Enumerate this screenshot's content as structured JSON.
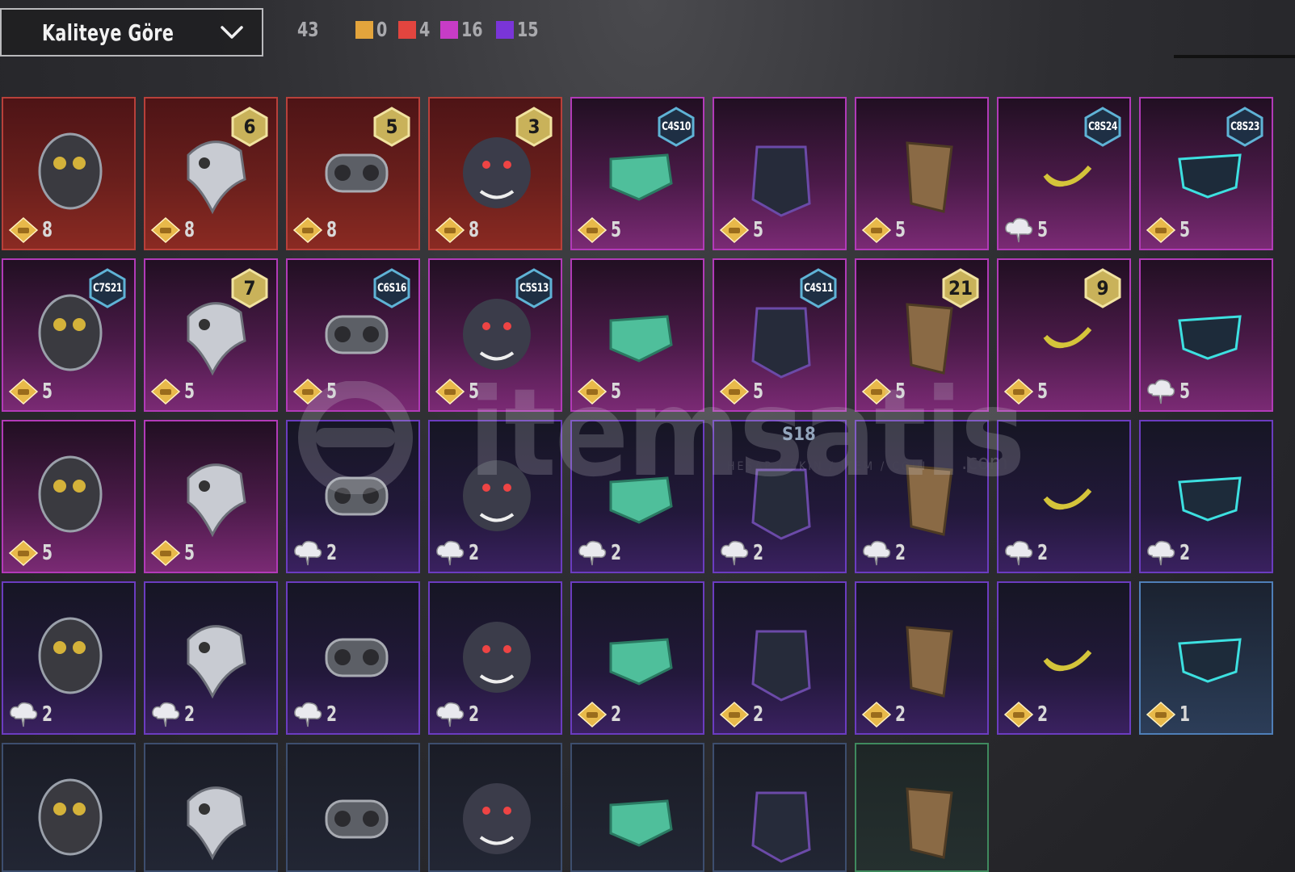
{
  "toolbar": {
    "sort_label": "Kaliteye Göre",
    "total_count": "43",
    "tiers": [
      {
        "color": "#e3a43c",
        "count": "0"
      },
      {
        "color": "#e2453f",
        "count": "4"
      },
      {
        "color": "#c73cc6",
        "count": "16"
      },
      {
        "color": "#7a35d8",
        "count": "15"
      }
    ]
  },
  "watermark": {
    "brand": "itemsatis",
    "tagline": "HESAP / SKIN / ITEM / COIN",
    "domain": ".com"
  },
  "labels": {
    "s18": "S18"
  },
  "cost_icons": {
    "gold": "gold-diamond-icon",
    "silver": "silver-cloud-coin-icon"
  },
  "items": [
    {
      "quality": "red",
      "icon": "helmet-mask-icon",
      "cost_type": "gold",
      "cost": "8",
      "badge": ""
    },
    {
      "quality": "red",
      "icon": "plague-doctor-mask-icon",
      "cost_type": "gold",
      "cost": "8",
      "badge": "6"
    },
    {
      "quality": "red",
      "icon": "gas-mask-icon",
      "cost_type": "gold",
      "cost": "8",
      "badge": "5"
    },
    {
      "quality": "red",
      "icon": "wolf-mask-icon",
      "cost_type": "gold",
      "cost": "8",
      "badge": "3"
    },
    {
      "quality": "pink",
      "icon": "face-mask-icon",
      "cost_type": "gold",
      "cost": "5",
      "badge": "C4S10",
      "season": true
    },
    {
      "quality": "pink",
      "icon": "bandana-icon",
      "cost_type": "gold",
      "cost": "5",
      "badge": ""
    },
    {
      "quality": "pink",
      "icon": "scarf-mask-icon",
      "cost_type": "gold",
      "cost": "5",
      "badge": ""
    },
    {
      "quality": "pink",
      "icon": "mustache-mask-icon",
      "cost_type": "silver",
      "cost": "5",
      "badge": "C8S24",
      "season": true
    },
    {
      "quality": "pink",
      "icon": "neon-mask-icon",
      "cost_type": "gold",
      "cost": "5",
      "badge": "C8S23",
      "season": true
    },
    {
      "quality": "pink",
      "icon": "robot-mask-icon",
      "cost_type": "gold",
      "cost": "5",
      "badge": "C7S21",
      "season": true
    },
    {
      "quality": "pink",
      "icon": "headset-mask-icon",
      "cost_type": "gold",
      "cost": "5",
      "badge": "7"
    },
    {
      "quality": "pink",
      "icon": "respirator-icon",
      "cost_type": "gold",
      "cost": "5",
      "badge": "C6S16",
      "season": true
    },
    {
      "quality": "pink",
      "icon": "graffiti-mask-icon",
      "cost_type": "gold",
      "cost": "5",
      "badge": "C5S13",
      "season": true
    },
    {
      "quality": "pink",
      "icon": "knight-mask-icon",
      "cost_type": "gold",
      "cost": "5",
      "badge": ""
    },
    {
      "quality": "pink",
      "icon": "cyber-mask-icon",
      "cost_type": "gold",
      "cost": "5",
      "badge": "C4S11",
      "season": true
    },
    {
      "quality": "pink",
      "icon": "joker-mask-icon",
      "cost_type": "gold",
      "cost": "5",
      "badge": "21"
    },
    {
      "quality": "pink",
      "icon": "armor-mask-icon",
      "cost_type": "gold",
      "cost": "5",
      "badge": "9"
    },
    {
      "quality": "pink",
      "icon": "skull-mask-icon",
      "cost_type": "silver",
      "cost": "5",
      "badge": ""
    },
    {
      "quality": "pink",
      "icon": "beak-mask-icon",
      "cost_type": "gold",
      "cost": "5",
      "badge": ""
    },
    {
      "quality": "pink",
      "icon": "skull-bandana-icon",
      "cost_type": "gold",
      "cost": "5",
      "badge": ""
    },
    {
      "quality": "purple",
      "icon": "laser-mask-icon",
      "cost_type": "silver",
      "cost": "2",
      "badge": ""
    },
    {
      "quality": "purple",
      "icon": "mammoth-mask-icon",
      "cost_type": "silver",
      "cost": "2",
      "badge": ""
    },
    {
      "quality": "purple",
      "icon": "pink-animal-mask-icon",
      "cost_type": "silver",
      "cost": "2",
      "badge": ""
    },
    {
      "quality": "purple",
      "icon": "heartbeat-mask-icon",
      "cost_type": "silver",
      "cost": "2",
      "badge": ""
    },
    {
      "quality": "purple",
      "icon": "purple-gas-mask-icon",
      "cost_type": "silver",
      "cost": "2",
      "badge": ""
    },
    {
      "quality": "purple",
      "icon": "black-mask-icon",
      "cost_type": "silver",
      "cost": "2",
      "badge": ""
    },
    {
      "quality": "purple",
      "icon": "visor-mask-icon",
      "cost_type": "silver",
      "cost": "2",
      "badge": ""
    },
    {
      "quality": "purple",
      "icon": "clown-mask-icon",
      "cost_type": "silver",
      "cost": "2",
      "badge": ""
    },
    {
      "quality": "purple",
      "icon": "cloth-mask-icon",
      "cost_type": "silver",
      "cost": "2",
      "badge": ""
    },
    {
      "quality": "purple",
      "icon": "hockey-mask-icon",
      "cost_type": "silver",
      "cost": "2",
      "badge": ""
    },
    {
      "quality": "purple",
      "icon": "grin-mask-icon",
      "cost_type": "silver",
      "cost": "2",
      "badge": ""
    },
    {
      "quality": "purple",
      "icon": "dark-skull-mask-icon",
      "cost_type": "gold",
      "cost": "2",
      "badge": ""
    },
    {
      "quality": "purple",
      "icon": "jaw-mask-icon",
      "cost_type": "gold",
      "cost": "2",
      "badge": ""
    },
    {
      "quality": "purple",
      "icon": "black-bandana-icon",
      "cost_type": "gold",
      "cost": "2",
      "badge": ""
    },
    {
      "quality": "purple",
      "icon": "red-scarf-icon",
      "cost_type": "gold",
      "cost": "2",
      "badge": ""
    },
    {
      "quality": "blue",
      "icon": "gold-skull-mask-icon",
      "cost_type": "gold",
      "cost": "1",
      "badge": ""
    },
    {
      "quality": "dark",
      "icon": "yellow-dot-bandana-icon",
      "cost_type": "",
      "cost": "",
      "badge": ""
    },
    {
      "quality": "dark",
      "icon": "spiderweb-bandana-icon",
      "cost_type": "",
      "cost": "",
      "badge": ""
    },
    {
      "quality": "dark",
      "icon": "purple-theater-mask-icon",
      "cost_type": "",
      "cost": "",
      "badge": ""
    },
    {
      "quality": "dark",
      "icon": "red-theater-mask-icon",
      "cost_type": "",
      "cost": "",
      "badge": ""
    },
    {
      "quality": "dark",
      "icon": "black-surgical-mask-icon",
      "cost_type": "",
      "cost": "",
      "badge": ""
    },
    {
      "quality": "dark",
      "icon": "respirator-dark-icon",
      "cost_type": "",
      "cost": "",
      "badge": ""
    },
    {
      "quality": "green",
      "icon": "gas-mask-classic-icon",
      "cost_type": "",
      "cost": "",
      "badge": ""
    }
  ]
}
